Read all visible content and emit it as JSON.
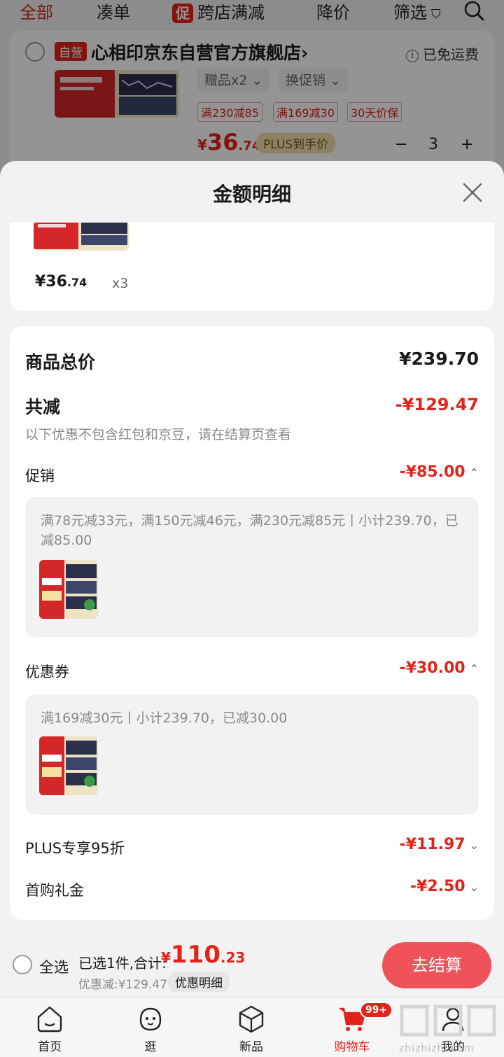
{
  "background": {
    "tabs": [
      "全部",
      "凑单",
      "跨店满减",
      "降价",
      "筛选"
    ],
    "promo_chip": "促",
    "store": {
      "badge": "自营",
      "name": "心相印京东自营官方旗舰店",
      "name_chevron": "›",
      "shipping": "已免运费",
      "spec_gift": "赠品x2",
      "spec_promo": "换促销",
      "tags": [
        "满230减85",
        "满169减30",
        "30天价保"
      ],
      "price_currency": "¥",
      "price_int": "36",
      "price_dec": ".74",
      "plus_tag": "PLUS到手价",
      "qty_minus": "−",
      "qty_value": "3",
      "qty_plus": "+"
    }
  },
  "sheet": {
    "title": "金额明细",
    "item": {
      "price_int": "¥36",
      "price_dec": ".74",
      "qty": "x3"
    },
    "total_label": "商品总价",
    "total_value": "¥239.70",
    "reduce_label": "共减",
    "reduce_value": "-¥129.47",
    "reduce_note": "以下优惠不包含红包和京豆，请在结算页查看",
    "promotion": {
      "label": "促销",
      "value": "-¥85.00",
      "detail": "满78元减33元，满150元减46元，满230元减85元丨小计239.70，已减85.00"
    },
    "coupon": {
      "label": "优惠券",
      "value": "-¥30.00",
      "detail": "满169减30元丨小计239.70，已减30.00"
    },
    "plus": {
      "label": "PLUS专享95折",
      "value": "-¥11.97"
    },
    "first_buy": {
      "label": "首购礼金",
      "value": "-¥2.50"
    },
    "chevron_up": "⌃",
    "chevron_down": "⌄"
  },
  "bottom_bar": {
    "select_all": "全选",
    "selected": "已选1件,合计:",
    "total_currency": "¥",
    "total_int": "110",
    "total_dec": ".23",
    "saved": "优惠减:¥129.47",
    "detail_button": "优惠明细",
    "checkout": "去结算"
  },
  "tabbar": {
    "items": [
      "首页",
      "逛",
      "新品",
      "购物车",
      "我的"
    ],
    "cart_badge": "99+"
  },
  "watermark": "zhizhizhi.com",
  "colors": {
    "accent": "#e2231a",
    "checkout": "#f0525a",
    "plus_gold": "#f3dfad"
  }
}
